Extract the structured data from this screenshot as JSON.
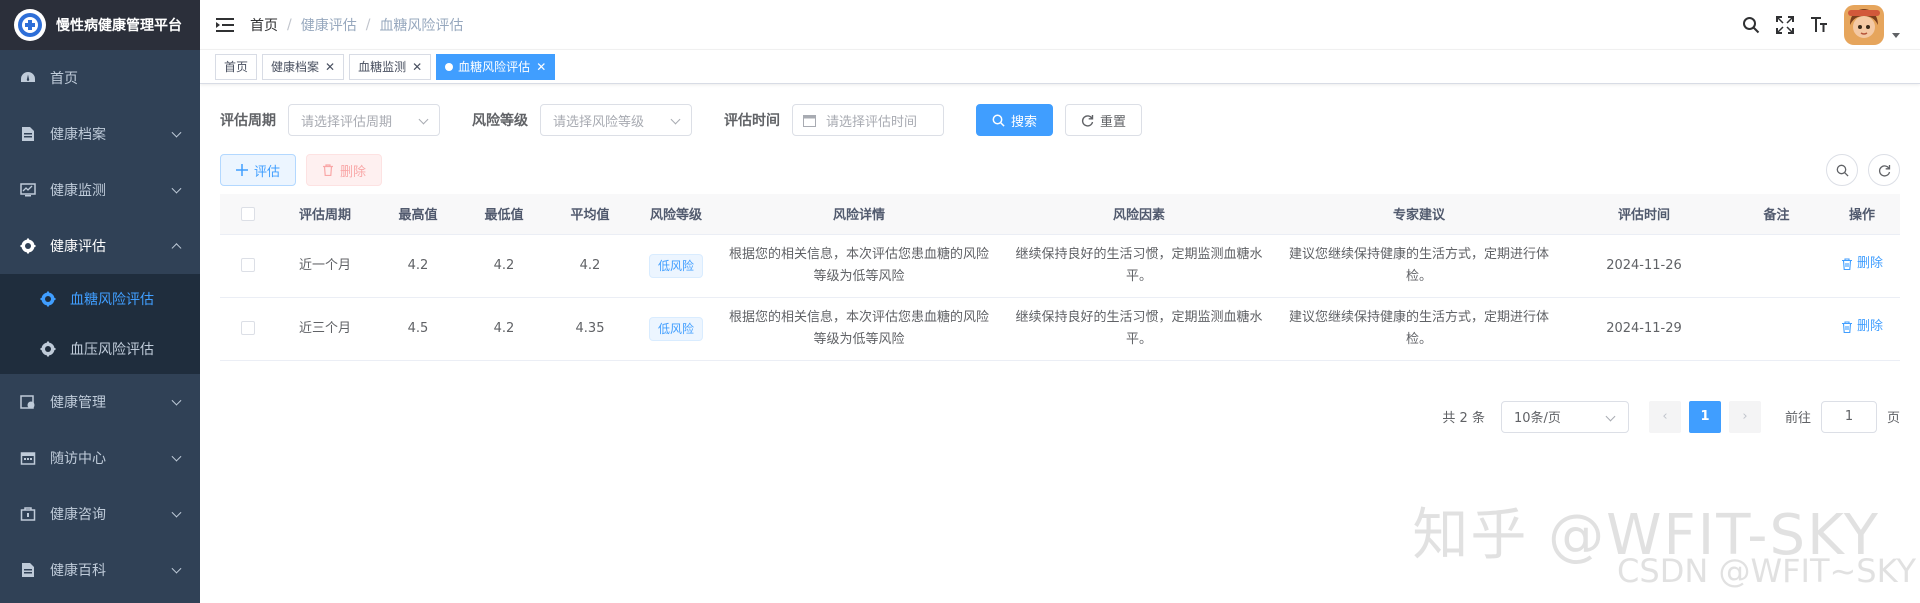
{
  "brand": {
    "title": "慢性病健康管理平台",
    "accent": "#409eff",
    "sidebar_bg": "#304156"
  },
  "sidebar": {
    "items": [
      {
        "label": "首页",
        "icon": "dashboard-icon"
      },
      {
        "label": "健康档案",
        "icon": "document-icon"
      },
      {
        "label": "健康监测",
        "icon": "monitor-icon"
      },
      {
        "label": "健康评估",
        "icon": "assessment-icon",
        "open": true
      },
      {
        "label": "健康管理",
        "icon": "health-manage-icon"
      },
      {
        "label": "随访中心",
        "icon": "calendar-icon"
      },
      {
        "label": "健康咨询",
        "icon": "consult-icon"
      },
      {
        "label": "健康百科",
        "icon": "book-icon"
      }
    ],
    "sub_items": [
      {
        "label": "血糖风险评估",
        "active": true
      },
      {
        "label": "血压风险评估",
        "active": false
      }
    ]
  },
  "breadcrumb": [
    "首页",
    "健康评估",
    "血糖风险评估"
  ],
  "tags": [
    "首页",
    "健康档案",
    "血糖监测",
    "血糖风险评估"
  ],
  "search": {
    "period_label": "评估周期",
    "period_placeholder": "请选择评估周期",
    "level_label": "风险等级",
    "level_placeholder": "请选择风险等级",
    "time_label": "评估时间",
    "time_placeholder": "请选择评估时间",
    "search_btn": "搜索",
    "reset_btn": "重置"
  },
  "toolbar": {
    "add_btn": "评估",
    "delete_btn": "删除"
  },
  "table": {
    "headers": [
      "评估周期",
      "最高值",
      "最低值",
      "平均值",
      "风险等级",
      "风险详情",
      "风险因素",
      "专家建议",
      "评估时间",
      "备注",
      "操作"
    ],
    "rows": [
      {
        "period": "近一个月",
        "max": "4.2",
        "min": "4.2",
        "avg": "4.2",
        "level": "低风险",
        "detail": "根据您的相关信息，本次评估您患血糖的风险等级为低等风险",
        "factor": "继续保持良好的生活习惯，定期监测血糖水平。",
        "advice": "建议您继续保持健康的生活方式，定期进行体检。",
        "time": "2024-11-26",
        "remark": "",
        "action": "删除"
      },
      {
        "period": "近三个月",
        "max": "4.5",
        "min": "4.2",
        "avg": "4.35",
        "level": "低风险",
        "detail": "根据您的相关信息，本次评估您患血糖的风险等级为低等风险",
        "factor": "继续保持良好的生活习惯，定期监测血糖水平。",
        "advice": "建议您继续保持健康的生活方式，定期进行体检。",
        "time": "2024-11-29",
        "remark": "",
        "action": "删除"
      }
    ]
  },
  "pagination": {
    "total": "共 2 条",
    "page_size": "10条/页",
    "current": "1",
    "goto_prefix": "前往",
    "goto_value": "1",
    "goto_suffix": "页"
  },
  "watermark": {
    "line1": "知乎 @WFIT-SKY",
    "line2": "CSDN @WFIT~SKY"
  }
}
